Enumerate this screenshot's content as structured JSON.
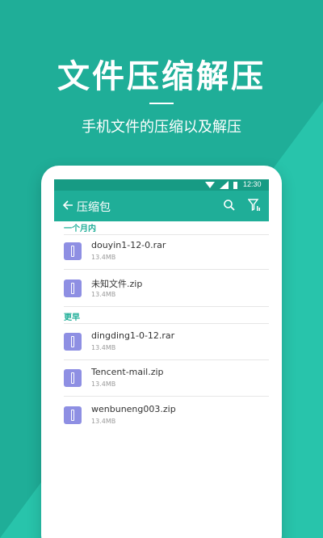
{
  "hero": {
    "title": "文件压缩解压",
    "subtitle": "手机文件的压缩以及解压"
  },
  "status_bar": {
    "time": "12:30"
  },
  "toolbar": {
    "title": "压缩包",
    "back_icon": "back-arrow-icon",
    "search_icon": "search-icon",
    "filter_icon": "filter-icon"
  },
  "sections": [
    {
      "header": "一个月内",
      "files": [
        {
          "name": "douyin1-12-0.rar",
          "size": "13.4MB"
        },
        {
          "name": "未知文件.zip",
          "size": "13.4MB"
        }
      ]
    },
    {
      "header": "更早",
      "files": [
        {
          "name": "dingding1-0-12.rar",
          "size": "13.4MB"
        },
        {
          "name": "Tencent-mail.zip",
          "size": "13.4MB"
        },
        {
          "name": "wenbuneng003.zip",
          "size": "13.4MB"
        }
      ]
    }
  ],
  "colors": {
    "primary": "#1fae98",
    "primary_dark": "#179b84",
    "light_diagonal": "#2cc9b0",
    "file_icon": "#8e8fe3"
  }
}
